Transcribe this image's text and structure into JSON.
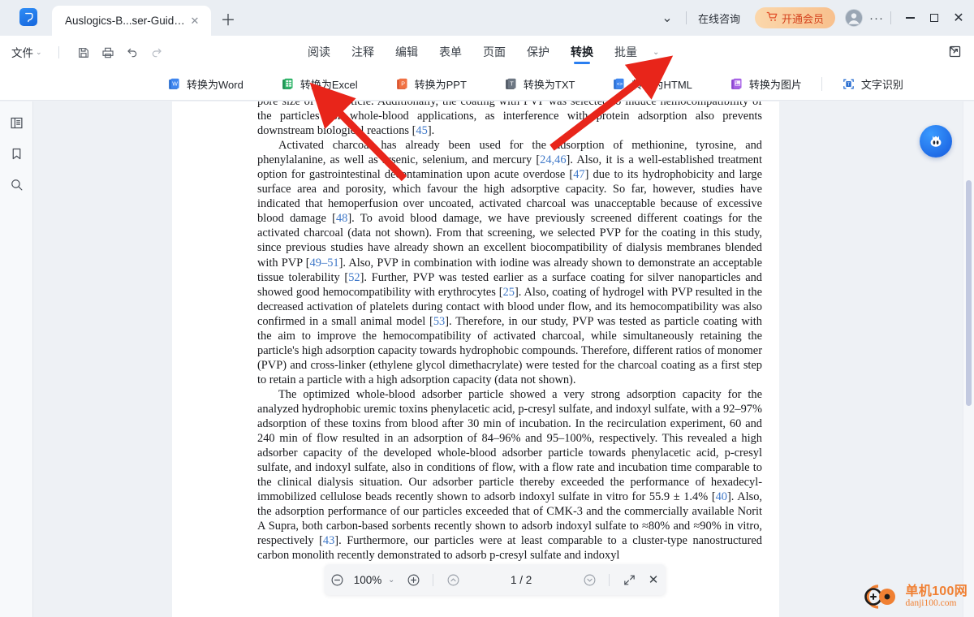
{
  "titlebar": {
    "tab_title": "Auslogics-B...ser-Guide *",
    "close_glyph": "✕",
    "newtab_glyph": "＋",
    "chevron_glyph": "⌄",
    "online_consult": "在线咨询",
    "vip_label": "开通会员",
    "cart_glyph": "🛒",
    "dots_glyph": "···",
    "minimize_glyph": "−",
    "maximize_glyph": "□",
    "close_window_glyph": "✕"
  },
  "menubar": {
    "file_label": "文件",
    "file_caret": "⌄",
    "quick_icons": [
      "save-icon",
      "print-icon",
      "undo-icon",
      "redo-icon"
    ],
    "tabs": [
      {
        "label": "阅读",
        "active": false
      },
      {
        "label": "注释",
        "active": false
      },
      {
        "label": "编辑",
        "active": false
      },
      {
        "label": "表单",
        "active": false
      },
      {
        "label": "页面",
        "active": false
      },
      {
        "label": "保护",
        "active": false
      },
      {
        "label": "转换",
        "active": true
      },
      {
        "label": "批量",
        "active": false
      }
    ],
    "more_caret": "⌄"
  },
  "toolbar": {
    "items": [
      {
        "label": "转换为Word",
        "icon": "word-icon",
        "color": "#2b6fd1"
      },
      {
        "label": "转换为Excel",
        "icon": "excel-icon",
        "color": "#1d9152"
      },
      {
        "label": "转换为PPT",
        "icon": "ppt-icon",
        "color": "#e06135"
      },
      {
        "label": "转换为TXT",
        "icon": "txt-icon",
        "color": "#5a6069"
      },
      {
        "label": "转换为HTML",
        "icon": "html-icon",
        "color": "#2b6fd1"
      },
      {
        "label": "转换为图片",
        "icon": "image-icon",
        "color": "#9b58d8"
      }
    ],
    "ocr": {
      "label": "文字识别",
      "icon": "ocr-icon",
      "color": "#2b6fd1"
    }
  },
  "leftrail": {
    "items": [
      {
        "icon": "thumbnails-icon",
        "name": "sidebar-thumbnails"
      },
      {
        "icon": "bookmark-icon",
        "name": "sidebar-bookmarks"
      },
      {
        "icon": "search-icon",
        "name": "sidebar-search"
      }
    ]
  },
  "document": {
    "paragraphs": [
      "pore size of the particle. Additionally, the coating with PVP was selected to induce hemocompatibility of the particles for whole-blood applications, as interference with protein adsorption also prevents downstream biological reactions [45].",
      "Activated charcoal has already been used for the adsorption of methionine, tyrosine, and phenylalanine, as well as arsenic, selenium, and mercury [24,46]. Also, it is a well-established treatment option for gastrointestinal decontamination upon acute overdose [47] due to its hydrophobicity and large surface area and porosity, which favour the high adsorptive capacity. So far, however, studies have indicated that hemoperfusion over uncoated, activated charcoal was unacceptable because of excessive blood damage [48]. To avoid blood damage, we have previously screened different coatings for the activated charcoal (data not shown). From that screening, we selected PVP for the coating in this study, since previous studies have already shown an excellent biocompatibility of dialysis membranes blended with PVP [49–51]. Also, PVP in combination with iodine was already shown to demonstrate an acceptable tissue tolerability [52]. Further, PVP was tested earlier as a surface coating for silver nanoparticles and showed good hemocompatibility with erythrocytes [25]. Also, coating of hydrogel with PVP resulted in the decreased activation of platelets during contact with blood under flow, and its hemocompatibility was also confirmed in a small animal model [53]. Therefore, in our study, PVP was tested as particle coating with the aim to improve the hemocompatibility of activated charcoal, while simultaneously retaining the particle's high adsorption capacity towards hydrophobic compounds. Therefore, different ratios of monomer (PVP) and cross-linker (ethylene glycol dimethacrylate) were tested for the charcoal coating as a first step to retain a particle with a high adsorption capacity (data not shown).",
      "The optimized whole-blood adsorber particle showed a very strong adsorption capacity for the analyzed hydrophobic uremic toxins phenylacetic acid, p-cresyl sulfate, and indoxyl sulfate, with a 92–97% adsorption of these toxins from blood after 30 min of incubation. In the recirculation experiment, 60 and 240 min of flow resulted in an adsorption of 84–96% and 95–100%, respectively. This revealed a high adsorber capacity of the developed whole-blood adsorber particle towards phenylacetic acid, p-cresyl sulfate, and indoxyl sulfate, also in conditions of flow, with a flow rate and incubation time comparable to the clinical dialysis situation. Our adsorber particle thereby exceeded the performance of hexadecyl-immobilized cellulose beads recently shown to adsorb indoxyl sulfate in vitro for 55.9 ± 1.4% [40]. Also, the adsorption performance of our particles exceeded that of CMK-3 and the commercially available Norit A Supra, both carbon-based sorbents recently shown to adsorb indoxyl sulfate to ≈80% and ≈90% in vitro, respectively [43]. Furthermore, our particles were at least comparable to a cluster-type nanostructured carbon monolith recently demonstrated to adsorb p-cresyl sulfate and indoxyl"
    ]
  },
  "pagebar": {
    "zoom_out": "zoom-out-icon",
    "zoom_value": "100%",
    "zoom_caret": "⌄",
    "zoom_in": "zoom-in-icon",
    "prev_page": "prev-page-icon",
    "page_indicator": "1 / 2",
    "next_page": "next-page-icon",
    "fit_glyph": "fit-screen-icon",
    "close_glyph": "✕"
  },
  "watermark": {
    "cn": "单机100网",
    "en": "danji100.com"
  },
  "assistant": {
    "icon": "ai-assistant-icon"
  },
  "colors": {
    "accent": "#2a7ef0",
    "vip": "#d4431e",
    "annotation_arrow": "#e8251a",
    "reference_link": "#3f78c8"
  }
}
